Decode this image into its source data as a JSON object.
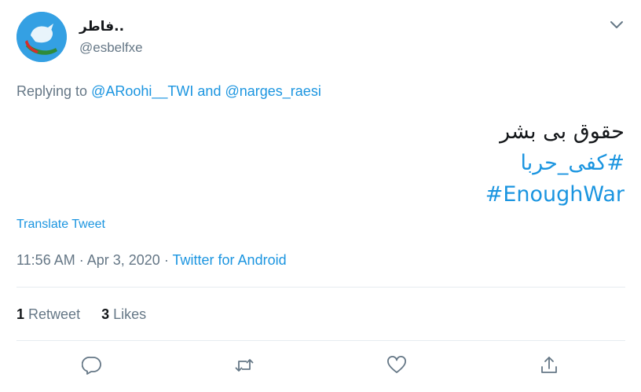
{
  "user": {
    "display_name": "فاطر..",
    "handle": "@esbelfxe"
  },
  "reply": {
    "prefix": "Replying to",
    "user1": "@ARoohi__TWI",
    "conjunction": "and",
    "user2": "@narges_raesi"
  },
  "tweet": {
    "line1": "حقوق بی بشر",
    "hashtag1": "#کفی_حربا",
    "hashtag2": "#EnoughWar"
  },
  "translate_label": "Translate Tweet",
  "meta": {
    "time": "11:56 AM",
    "sep1": "·",
    "date": "Apr 3, 2020",
    "sep2": "·",
    "source": "Twitter for Android"
  },
  "stats": {
    "retweets_count": "1",
    "retweets_label": "Retweet",
    "likes_count": "3",
    "likes_label": "Likes"
  },
  "colors": {
    "link": "#1b95e0",
    "secondary_text": "#657786",
    "divider": "#e6ecf0",
    "avatar_bg": "#34a0e3"
  },
  "icons": {
    "caret": "chevron-down-icon",
    "reply": "reply-icon",
    "retweet": "retweet-icon",
    "like": "heart-icon",
    "share": "share-icon"
  }
}
